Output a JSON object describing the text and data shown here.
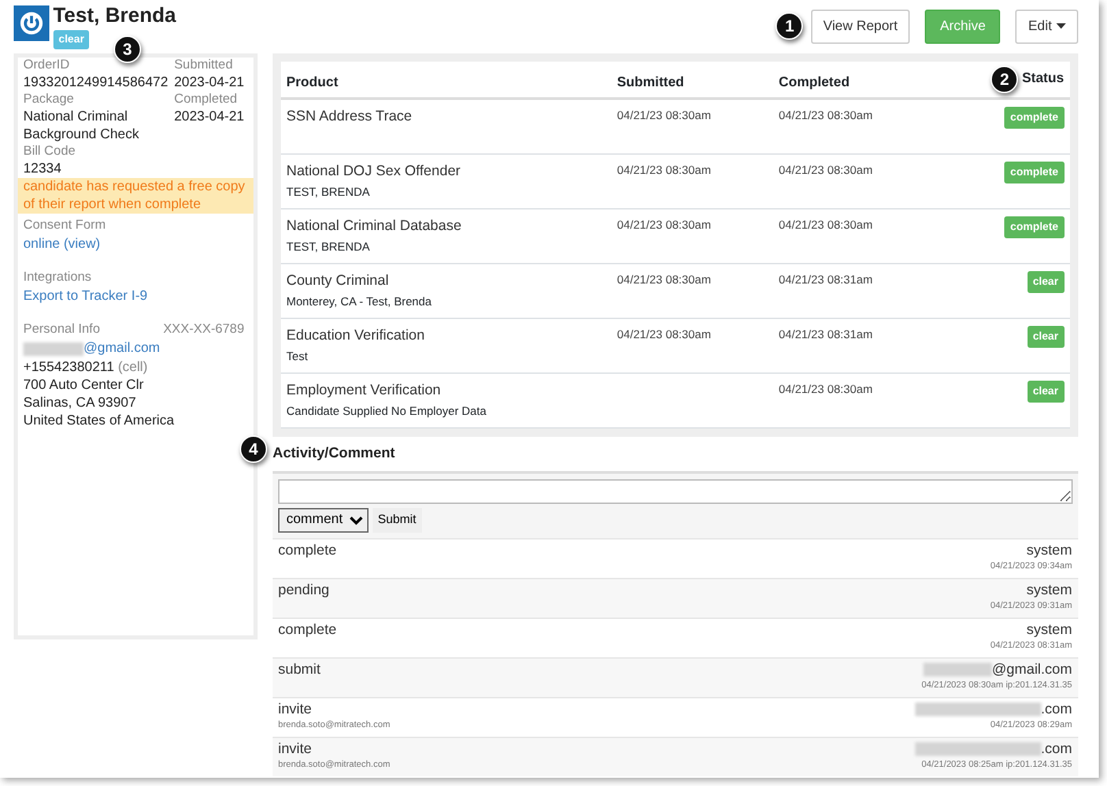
{
  "header": {
    "name": "Test, Brenda",
    "status": "clear",
    "buttons": [
      {
        "label": "View Report",
        "kind": "default"
      },
      {
        "label": "Archive",
        "kind": "success"
      },
      {
        "label": "Edit",
        "kind": "dropdown"
      }
    ]
  },
  "info_panel": {
    "left_fields": [
      {
        "label": "OrderID",
        "value": "1933201249914586472"
      },
      {
        "label": "Package",
        "value": "National Criminal Background Check"
      },
      {
        "label": "Bill Code",
        "value": "12334"
      }
    ],
    "right_fields": [
      {
        "label": "Submitted",
        "value": "2023-04-21"
      },
      {
        "label": "Completed",
        "value": "2023-04-21"
      }
    ],
    "notice": "candidate has requested a free copy of their report when complete",
    "consent": {
      "label": "Consent Form",
      "link": "online (view)"
    },
    "integrations": {
      "label": "Integrations",
      "link": "Export to Tracker I-9"
    },
    "personal": {
      "label": "Personal Info",
      "ssn": "XXX-XX-6789",
      "email": "@gmail.com",
      "email_redacted": true,
      "phone": "+15542380211",
      "phone_type": "(cell)",
      "address_lines": [
        "700 Auto Center Clr",
        "Salinas, CA 93907",
        "United States of America"
      ]
    }
  },
  "products": {
    "columns": [
      "Product",
      "Submitted",
      "Completed",
      "Status"
    ],
    "rows": [
      {
        "product": "SSN Address Trace",
        "submitted": "04/21/23 08:30am",
        "completed": "04/21/23 08:30am",
        "status": "complete"
      },
      {
        "product": "National DOJ Sex Offender",
        "detail": "TEST, BRENDA",
        "submitted": "04/21/23 08:30am",
        "completed": "04/21/23 08:30am",
        "status": "complete"
      },
      {
        "product": "National Criminal Database",
        "detail": "TEST, BRENDA",
        "submitted": "04/21/23 08:30am",
        "completed": "04/21/23 08:30am",
        "status": "complete"
      },
      {
        "product": "County Criminal",
        "detail": "Monterey, CA - Test, Brenda",
        "submitted": "04/21/23 08:30am",
        "completed": "04/21/23 08:31am",
        "status": "clear"
      },
      {
        "product": "Education Verification",
        "detail": "Test",
        "submitted": "04/21/23 08:30am",
        "completed": "04/21/23 08:31am",
        "status": "clear"
      },
      {
        "product": "Employment Verification",
        "detail": "Candidate Supplied No Employer Data",
        "completed": "04/21/23 08:30am",
        "status": "clear"
      }
    ]
  },
  "activity": {
    "title": "Activity/Comment",
    "type_select": "comment",
    "submit": "Submit",
    "entries": [
      {
        "action": "complete",
        "user": "system",
        "user_redacted": false,
        "time": "04/21/2023 09:34am"
      },
      {
        "action": "pending",
        "user": "system",
        "user_redacted": false,
        "time": "04/21/2023 09:31am"
      },
      {
        "action": "complete",
        "user": "system",
        "user_redacted": false,
        "time": "04/21/2023 08:31am"
      },
      {
        "action": "submit",
        "user": "@gmail.com",
        "user_redacted": true,
        "time": "04/21/2023 08:30am ip:201.124.31.35"
      },
      {
        "action": "invite",
        "note": "brenda.soto@mitratech.com",
        "user": ".com",
        "user_redacted": true,
        "time": "04/21/2023 08:29am"
      },
      {
        "action": "invite",
        "note": "brenda.soto@mitratech.com",
        "user": ".com",
        "user_redacted": true,
        "time": "04/21/2023 08:25am ip:201.124.31.35"
      }
    ]
  },
  "callouts": [
    {
      "label": "1"
    },
    {
      "label": "2"
    },
    {
      "label": "3"
    },
    {
      "label": "4"
    }
  ]
}
